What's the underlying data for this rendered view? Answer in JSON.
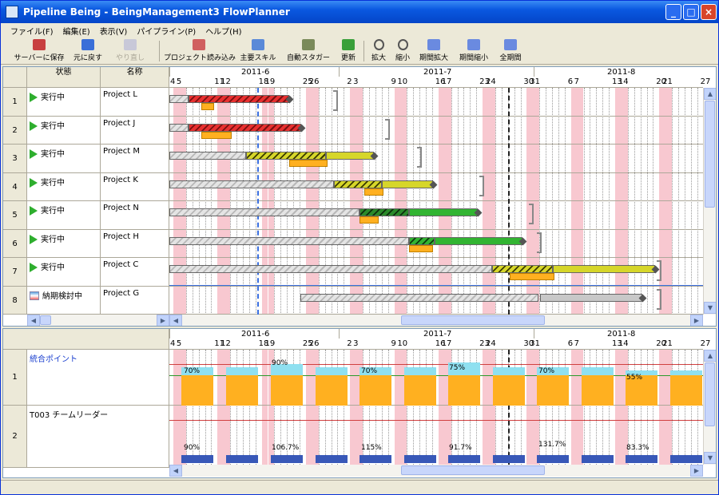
{
  "window": {
    "title": "Pipeline Being - BeingManagement3 FlowPlanner",
    "buttons": [
      "_",
      "□",
      "×"
    ]
  },
  "menu": [
    "ファイル(F)",
    "編集(E)",
    "表示(V)",
    "パイプライン(P)",
    "ヘルプ(H)"
  ],
  "toolbar": [
    {
      "label": "サーバーに保存",
      "icon": "server-save-icon"
    },
    {
      "label": "元に戻す",
      "icon": "undo-icon"
    },
    {
      "label": "やり直し",
      "icon": "redo-icon",
      "disabled": true
    },
    {
      "label": "プロジェクト読み込み",
      "icon": "project-load-icon"
    },
    {
      "label": "主要スキル",
      "icon": "skill-icon"
    },
    {
      "label": "自動スタガー",
      "icon": "auto-stagger-icon"
    },
    {
      "label": "更新",
      "icon": "refresh-icon"
    },
    {
      "label": "拡大",
      "icon": "zoom-in-icon"
    },
    {
      "label": "縮小",
      "icon": "zoom-out-icon"
    },
    {
      "label": "期間拡大",
      "icon": "period-expand-icon"
    },
    {
      "label": "期間縮小",
      "icon": "period-shrink-icon"
    },
    {
      "label": "全期間",
      "icon": "full-period-icon"
    }
  ],
  "grid": {
    "col_status": "状態",
    "col_name": "名称",
    "rows": [
      {
        "num": "1",
        "status": "実行中",
        "name": "Project L",
        "icon": "play-icon"
      },
      {
        "num": "2",
        "status": "実行中",
        "name": "Project  J",
        "icon": "play-icon"
      },
      {
        "num": "3",
        "status": "実行中",
        "name": "Project M",
        "icon": "play-icon"
      },
      {
        "num": "4",
        "status": "実行中",
        "name": "Project K",
        "icon": "play-icon"
      },
      {
        "num": "5",
        "status": "実行中",
        "name": "Project N",
        "icon": "play-icon"
      },
      {
        "num": "6",
        "status": "実行中",
        "name": "Project H",
        "icon": "play-icon"
      },
      {
        "num": "7",
        "status": "実行中",
        "name": "Project C",
        "icon": "play-icon"
      },
      {
        "num": "8",
        "status": "納期検討中",
        "name": "Project G",
        "icon": "schedule-icon"
      }
    ]
  },
  "timeline": {
    "months": [
      "2011-6",
      "2011-7",
      "2011-8"
    ],
    "day_labels": [
      "4",
      "5",
      "11",
      "12",
      "18",
      "19",
      "25",
      "26",
      "2",
      "3",
      "9",
      "10",
      "16",
      "17",
      "23",
      "24",
      "30",
      "31",
      "6",
      "7",
      "13",
      "14",
      "20",
      "21",
      "27"
    ]
  },
  "resources": {
    "rows": [
      {
        "num": "1",
        "name": "統合ポイント",
        "percents": [
          "70%",
          "90%",
          "70%",
          "75%",
          "70%",
          "55%"
        ]
      },
      {
        "num": "2",
        "name": "T003 チームリーダー",
        "percents": [
          "90%",
          "106.7%",
          "115%",
          "91.7%",
          "131.7%",
          "83.3%"
        ]
      }
    ]
  },
  "colors": {
    "weekend": "#f8c8d0",
    "red_bar": "#e83030",
    "yellow_bar": "#d6d62a",
    "green_bar": "#32b432",
    "orange_bar": "#ffb020",
    "gray_bar": "#c8c8c8",
    "cyan_band": "#8fe0f0",
    "blue_band": "#3858b8"
  }
}
